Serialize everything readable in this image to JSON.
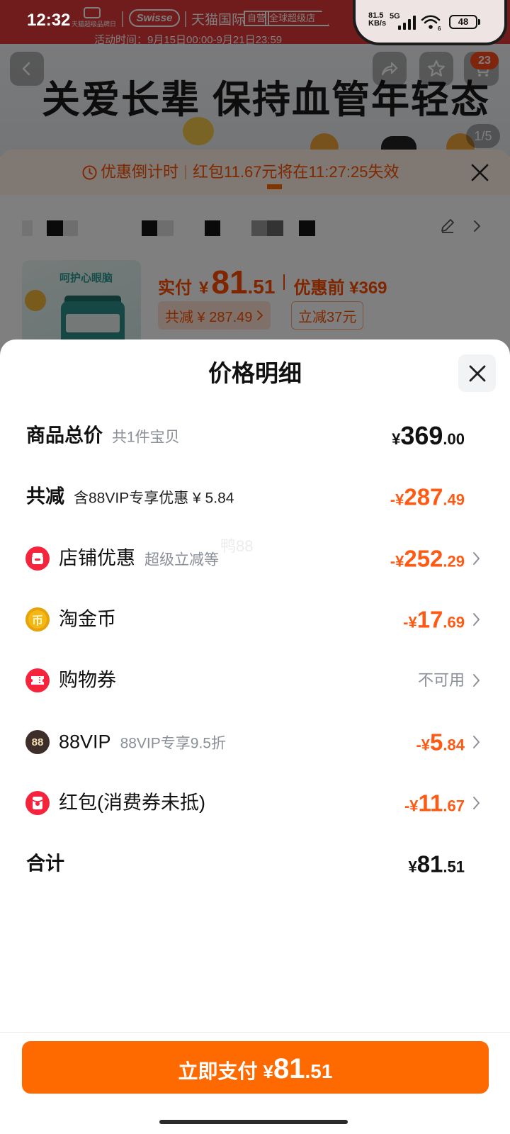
{
  "status_bar": {
    "time": "12:32",
    "net_speed": "81.5",
    "net_speed_unit": "KB/s",
    "network_type": "5G",
    "wifi_standard": "6",
    "battery_level": "48"
  },
  "header": {
    "event_caption": "天猫超级品牌日",
    "brand_logo": "Swisse",
    "channel": "天猫国际",
    "badge_self_run": "自营",
    "badge_global_store": "全球超级店",
    "activity_time": "活动时间：9月15日00:00-9月21日23:59"
  },
  "banner": {
    "headline": "关爱长辈 保持血管年轻态",
    "cart_badge": "23",
    "image_counter": "1/5"
  },
  "countdown": {
    "label": "优惠倒计时",
    "message": "红包11.67元将在11:27:25失效"
  },
  "product": {
    "image_caption": "呵护心眼脑",
    "paid_label": "实付",
    "currency": "¥",
    "paid_int": "81",
    "paid_dec": ".51",
    "before_discount": "优惠前 ¥369",
    "total_discount_tag": "共减 ¥ 287.49",
    "instant_discount_tag": "立减37元"
  },
  "sheet": {
    "title": "价格明细",
    "watermark": "鸭88",
    "rows": [
      {
        "label": "商品总价",
        "sub": "共1件宝贝",
        "prefix": "¥",
        "int": "369",
        "dec": ".00"
      },
      {
        "label": "共减",
        "sub": "含88VIP专享优惠 ¥ 5.84",
        "prefix": "-¥",
        "int": "287",
        "dec": ".49"
      },
      {
        "icon": "shop-icon",
        "label": "店铺优惠",
        "sub": "超级立减等",
        "prefix": "-¥",
        "int": "252",
        "dec": ".29"
      },
      {
        "icon": "gold-coin-icon",
        "icon_text": "币",
        "label": "淘金币",
        "prefix": "-¥",
        "int": "17",
        "dec": ".69"
      },
      {
        "icon": "coupon-icon",
        "label": "购物券",
        "status": "不可用"
      },
      {
        "icon": "vip-88-icon",
        "icon_text": "88",
        "label": "88VIP",
        "sub": "88VIP专享9.5折",
        "prefix": "-¥",
        "int": "5",
        "dec": ".84"
      },
      {
        "icon": "red-packet-icon",
        "label": "红包(消费券未抵)",
        "prefix": "-¥",
        "int": "11",
        "dec": ".67"
      }
    ],
    "total": {
      "label": "合计",
      "prefix": "¥",
      "int": "81",
      "dec": ".51"
    }
  },
  "pay_button": {
    "label": "立即支付",
    "currency": "¥",
    "int": "81",
    "dec": ".51"
  },
  "colors": {
    "accent": "#ff6a00",
    "discount_price": "#ff5a14",
    "header_red": "#e13838",
    "text": "#111111",
    "muted": "#8a8f99",
    "icon_red": "#f5243c",
    "coin_gold": "#f3b814",
    "vip_brown": "#3d2e29"
  }
}
